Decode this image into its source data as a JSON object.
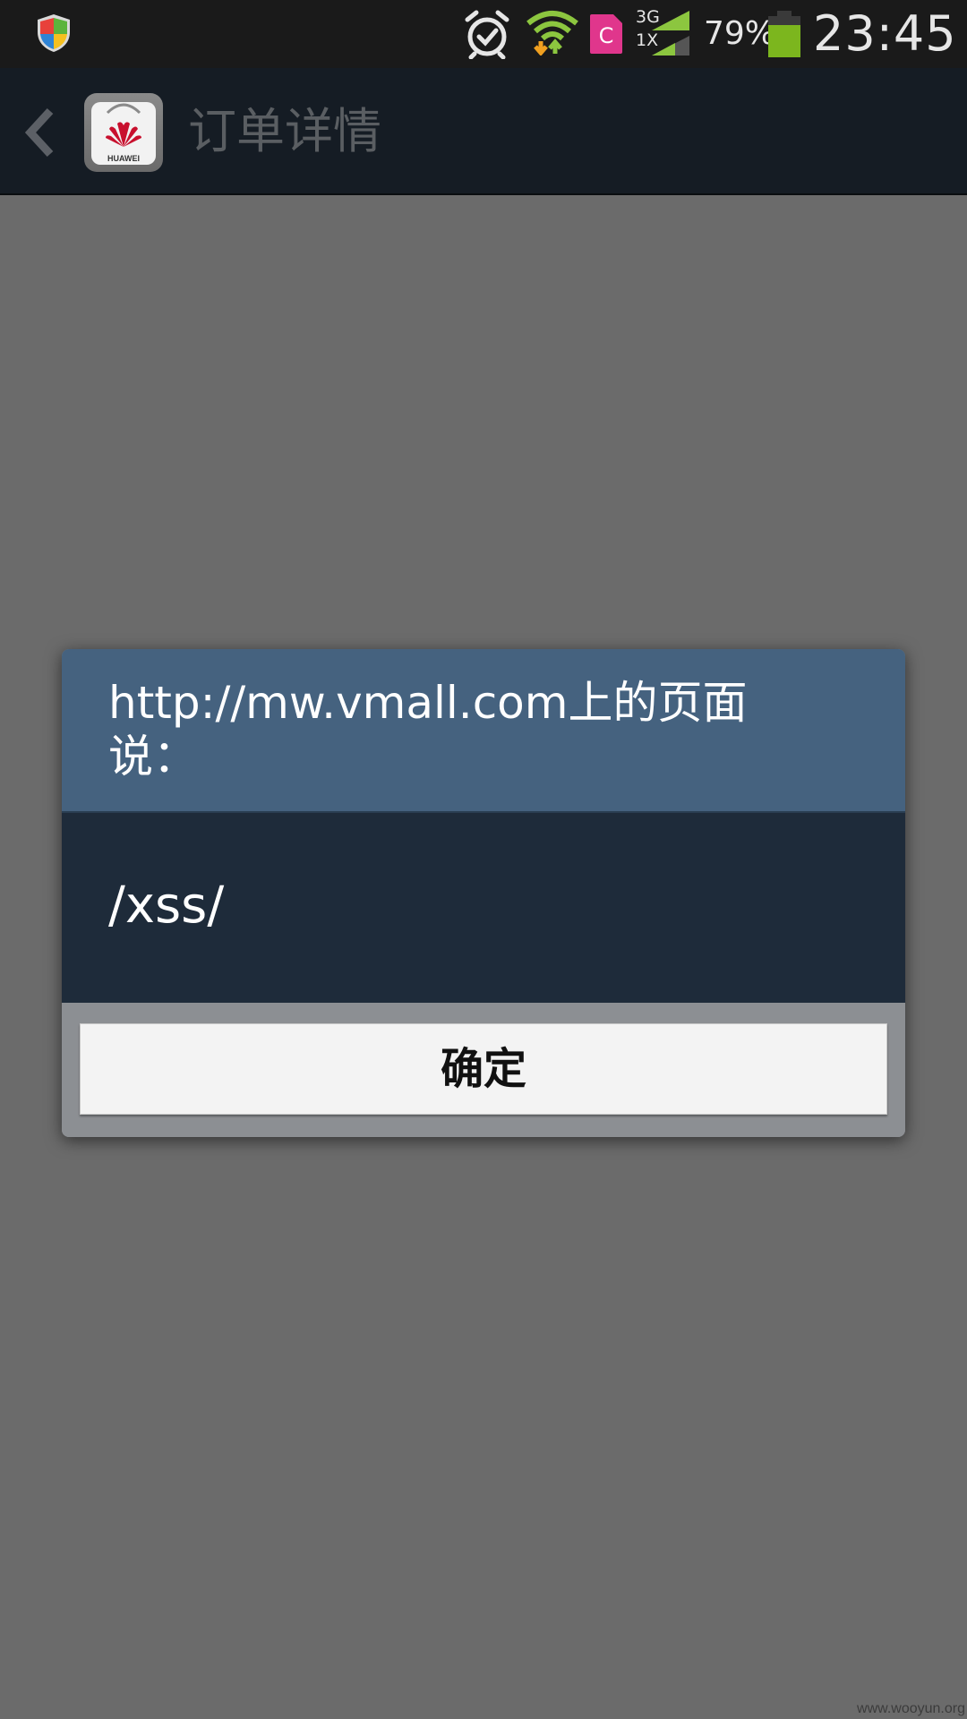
{
  "status_bar": {
    "icons": [
      "shield-icon",
      "alarm-icon",
      "wifi-icon",
      "sim-c-icon",
      "signal-icon",
      "battery-icon"
    ],
    "network_top": "3G",
    "network_bottom": "1X",
    "battery_percent": "79%",
    "time": "23:45"
  },
  "action_bar": {
    "back_icon": "chevron-left-icon",
    "app_icon_brand": "HUAWEI",
    "title": "订单详情"
  },
  "dialog": {
    "title": "http://mw.vmall.com上的页面\n说：",
    "message": "/xss/",
    "ok_label": "确定"
  },
  "watermark": "www.wooyun.org",
  "colors": {
    "background_dim": "#6b6b6b",
    "status_bar": "#1a1a1a",
    "action_bar": "#151c24",
    "dialog_header": "#45627f",
    "dialog_body": "#1e2b3a",
    "button": "#f3f3f3"
  }
}
